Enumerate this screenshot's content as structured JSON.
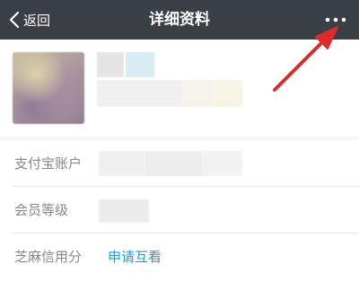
{
  "header": {
    "back_label": "返回",
    "title": "详细资料",
    "back_icon": "chevron-left-icon",
    "more_icon": "more-horizontal-icon"
  },
  "profile": {
    "avatar": "blurred-avatar"
  },
  "info_rows": [
    {
      "label": "支付宝账户",
      "value": ""
    },
    {
      "label": "会员等级",
      "value": ""
    },
    {
      "label": "芝麻信用分",
      "value": "申请互看"
    }
  ],
  "colors": {
    "header_bg": "#3a3f46",
    "link": "#1a9fe0",
    "label": "#888888",
    "annotation": "#e02a2a"
  }
}
